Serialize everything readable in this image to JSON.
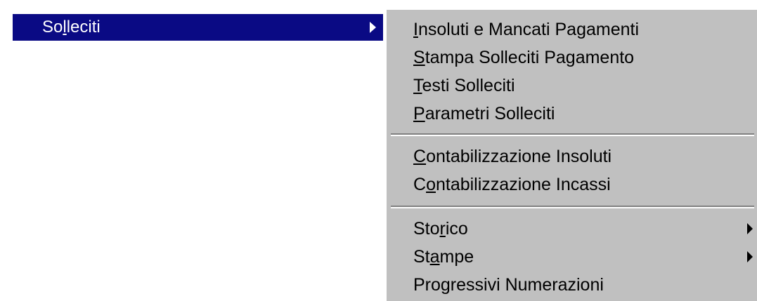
{
  "parent_menu": {
    "item": {
      "label_parts": [
        "So",
        "l",
        "leciti"
      ],
      "has_submenu": true,
      "highlighted": true
    }
  },
  "submenu": {
    "items": [
      {
        "label_parts": [
          "",
          "I",
          "nsoluti e Mancati Pagamenti"
        ]
      },
      {
        "label_parts": [
          "",
          "S",
          "tampa Solleciti Pagamento"
        ]
      },
      {
        "label_parts": [
          "",
          "T",
          "esti Solleciti"
        ]
      },
      {
        "label_parts": [
          "",
          "P",
          "arametri Solleciti"
        ]
      },
      {
        "label_parts": [
          "",
          "C",
          "ontabilizzazione Insoluti"
        ]
      },
      {
        "label_parts": [
          "C",
          "o",
          "ntabilizzazione Incassi"
        ]
      },
      {
        "label_parts": [
          "Sto",
          "r",
          "ico"
        ],
        "has_submenu": true
      },
      {
        "label_parts": [
          "St",
          "a",
          "mpe"
        ],
        "has_submenu": true
      },
      {
        "label_parts": [
          "Progressivi Numerazioni",
          "",
          ""
        ]
      }
    ]
  },
  "colors": {
    "highlight": "#0a0a84",
    "menu_background": "#c0c0c0",
    "separator_dark": "#808080"
  }
}
